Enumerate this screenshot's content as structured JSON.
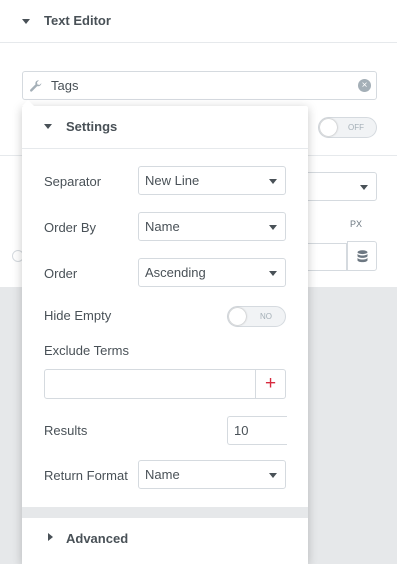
{
  "panel": {
    "title": "Text Editor",
    "dynamic_tag": {
      "label": "Tags"
    },
    "background_toggle": "OFF",
    "units_label": "PX"
  },
  "popover": {
    "settings_title": "Settings",
    "fields": {
      "separator": {
        "label": "Separator",
        "value": "New Line"
      },
      "order_by": {
        "label": "Order By",
        "value": "Name"
      },
      "order": {
        "label": "Order",
        "value": "Ascending"
      },
      "hide_empty": {
        "label": "Hide Empty",
        "toggle_text": "NO"
      },
      "exclude_terms": {
        "label": "Exclude Terms",
        "value": "",
        "add_symbol": "+"
      },
      "results": {
        "label": "Results",
        "value": "10"
      },
      "return_format": {
        "label": "Return Format",
        "value": "Name"
      }
    },
    "advanced_title": "Advanced"
  },
  "colors": {
    "text": "#495157",
    "border": "#d5dadf",
    "accent_plus": "#d72b3f",
    "muted_bg": "#e6e8ea"
  },
  "icons": {
    "section_caret": "caret-down-icon",
    "tag_icon": "wrench-icon",
    "clear": "close-circle-icon",
    "dynamic": "database-icon",
    "advanced_caret": "caret-right-icon"
  }
}
